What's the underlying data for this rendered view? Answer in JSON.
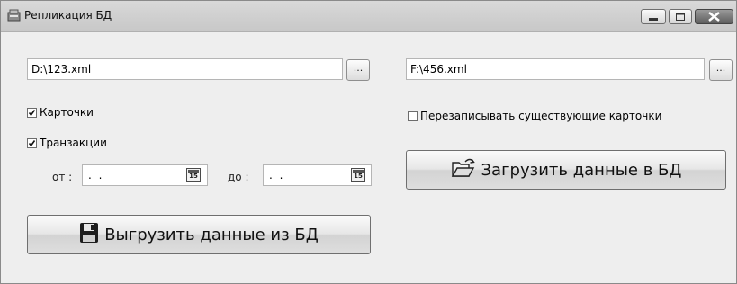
{
  "window": {
    "title": "Репликация БД"
  },
  "export": {
    "path_value": "D:\\123.xml",
    "browse_label": "...",
    "cards_label": "Карточки",
    "transactions_label": "Транзакции",
    "from_label": "от :",
    "from_value": ". .",
    "to_label": "до :",
    "to_value": ". .",
    "calendar_glyph": "15",
    "button_label": "Выгрузить данные из БД",
    "cards_checked": true,
    "transactions_checked": true
  },
  "import": {
    "path_value": "F:\\456.xml",
    "browse_label": "...",
    "overwrite_label": "Перезаписывать существующие карточки",
    "overwrite_checked": false,
    "button_label": "Загрузить данные в БД"
  },
  "icons": {
    "app": "database-app-icon",
    "export": "floppy-disk-icon",
    "import": "open-folder-icon"
  }
}
